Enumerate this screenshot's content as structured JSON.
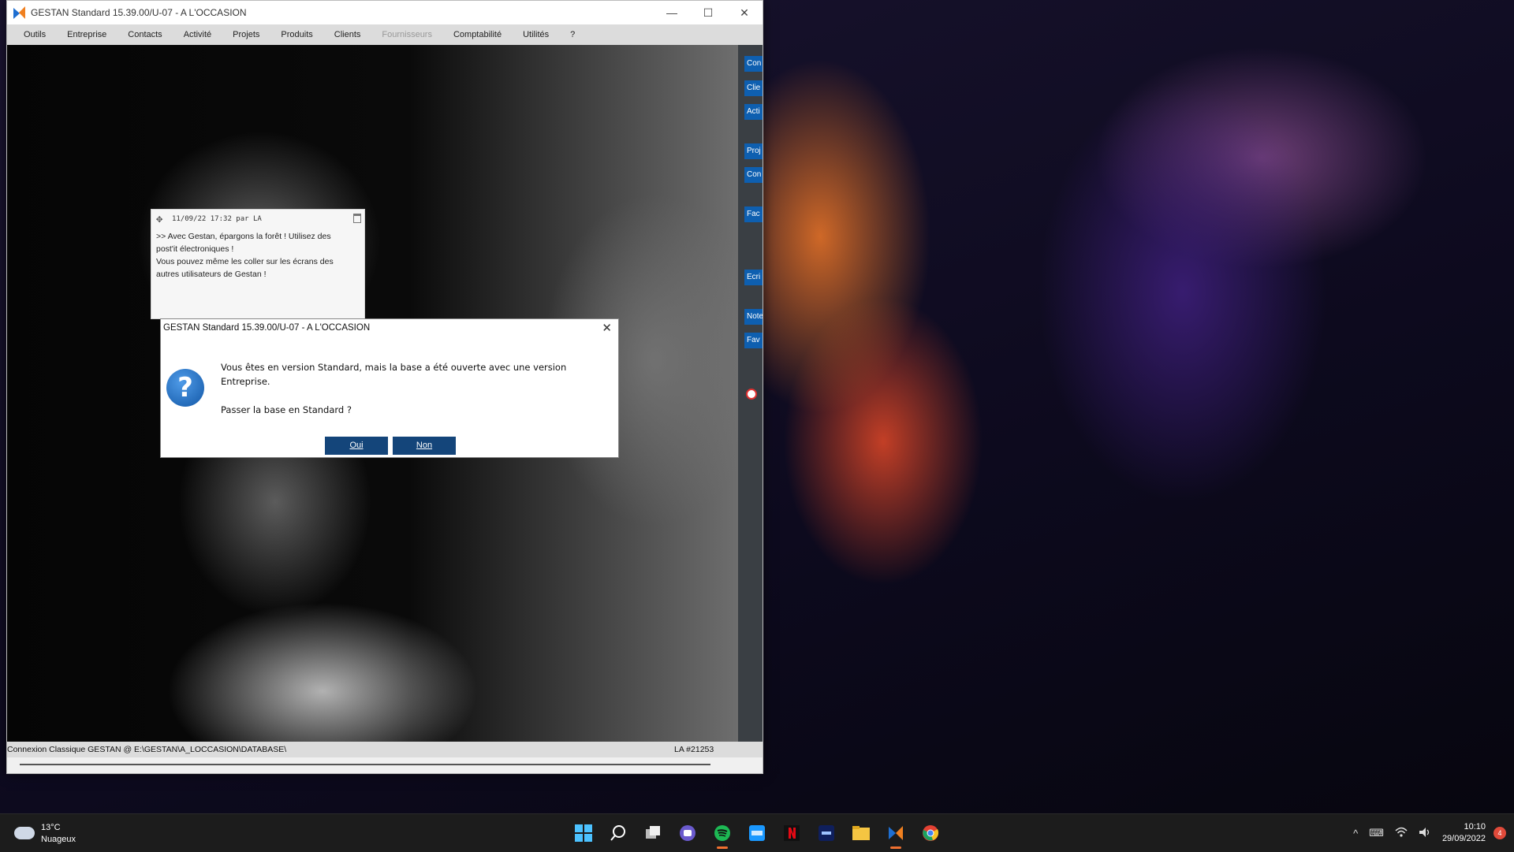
{
  "window": {
    "title": "GESTAN Standard 15.39.00/U-07 - A L'OCCASION",
    "minimize": "—",
    "maximize": "☐",
    "close": "✕"
  },
  "menu": [
    {
      "label": "Outils"
    },
    {
      "label": "Entreprise"
    },
    {
      "label": "Contacts"
    },
    {
      "label": "Activité"
    },
    {
      "label": "Projets"
    },
    {
      "label": "Produits"
    },
    {
      "label": "Clients"
    },
    {
      "label": "Fournisseurs",
      "disabled": true
    },
    {
      "label": "Comptabilité"
    },
    {
      "label": "Utilités"
    },
    {
      "label": "?"
    }
  ],
  "side_buttons": [
    "Con",
    "Clie",
    "Acti",
    "Proj",
    "Con",
    "Fac",
    "Ecri",
    "Note",
    "Fav"
  ],
  "note": {
    "header": "11/09/22 17:32 par LA",
    "lines": [
      ">> Avec Gestan, épargons la forêt ! Utilisez des",
      "post'it électroniques !",
      "Vous pouvez même les coller sur les écrans des",
      "autres utilisateurs de Gestan !"
    ]
  },
  "dialog": {
    "title": "GESTAN Standard 15.39.00/U-07 - A L'OCCASION",
    "message_line1": "Vous êtes en version Standard, mais la base a été ouverte avec une version",
    "message_line2": "Entreprise.",
    "question": "Passer la base en Standard ?",
    "yes_label": "Oui",
    "no_label": "Non",
    "close": "✕"
  },
  "statusbar": {
    "connection": "Connexion Classique GESTAN @ E:\\GESTAN\\A_LOCCASION\\DATABASE\\",
    "user": "LA #21253"
  },
  "taskbar": {
    "weather_temp": "13°C",
    "weather_desc": "Nuageux",
    "time": "10:10",
    "date": "29/09/2022",
    "notifications": "4"
  },
  "colors": {
    "dialog_button": "#14457a",
    "side_button": "#0e5fb0"
  }
}
